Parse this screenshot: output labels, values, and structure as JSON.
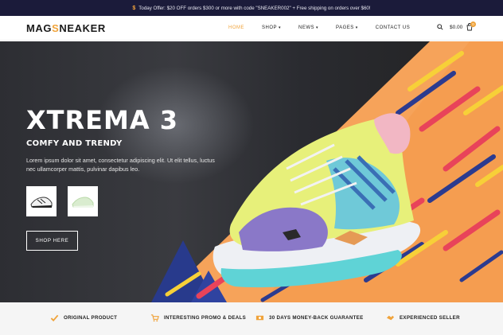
{
  "promo": {
    "icon": "dollar-icon",
    "text": "Today Offer: $20 OFF orders $300 or more with code \"SNEAKER002\" + Free shipping on orders over $60!"
  },
  "header": {
    "logo_part1": "MAG",
    "logo_part2": "S",
    "logo_part3": "NEAKER",
    "nav": [
      {
        "label": "HOME",
        "active": true
      },
      {
        "label": "SHOP"
      },
      {
        "label": "NEWS"
      },
      {
        "label": "PAGES"
      },
      {
        "label": "CONTACT US"
      }
    ],
    "cart_total": "$0.00",
    "cart_count": "0",
    "accent": "#f0a33a"
  },
  "hero": {
    "title": "XTREMA 3",
    "subtitle": "COMFY AND TRENDY",
    "description": "Lorem ipsum dolor sit amet, consectetur adipiscing elit. Ut elit tellus, luctus nec ullamcorper mattis, pulvinar dapibus leo.",
    "button": "SHOP HERE"
  },
  "features": [
    {
      "icon": "check-icon",
      "label": "ORIGINAL PRODUCT"
    },
    {
      "icon": "cart-icon",
      "label": "INTERESTING PROMO & DEALS"
    },
    {
      "icon": "money-icon",
      "label": "30 DAYS MONEY-BACK GUARANTEE"
    },
    {
      "icon": "handshake-icon",
      "label": "EXPERIENCED SELLER"
    }
  ]
}
